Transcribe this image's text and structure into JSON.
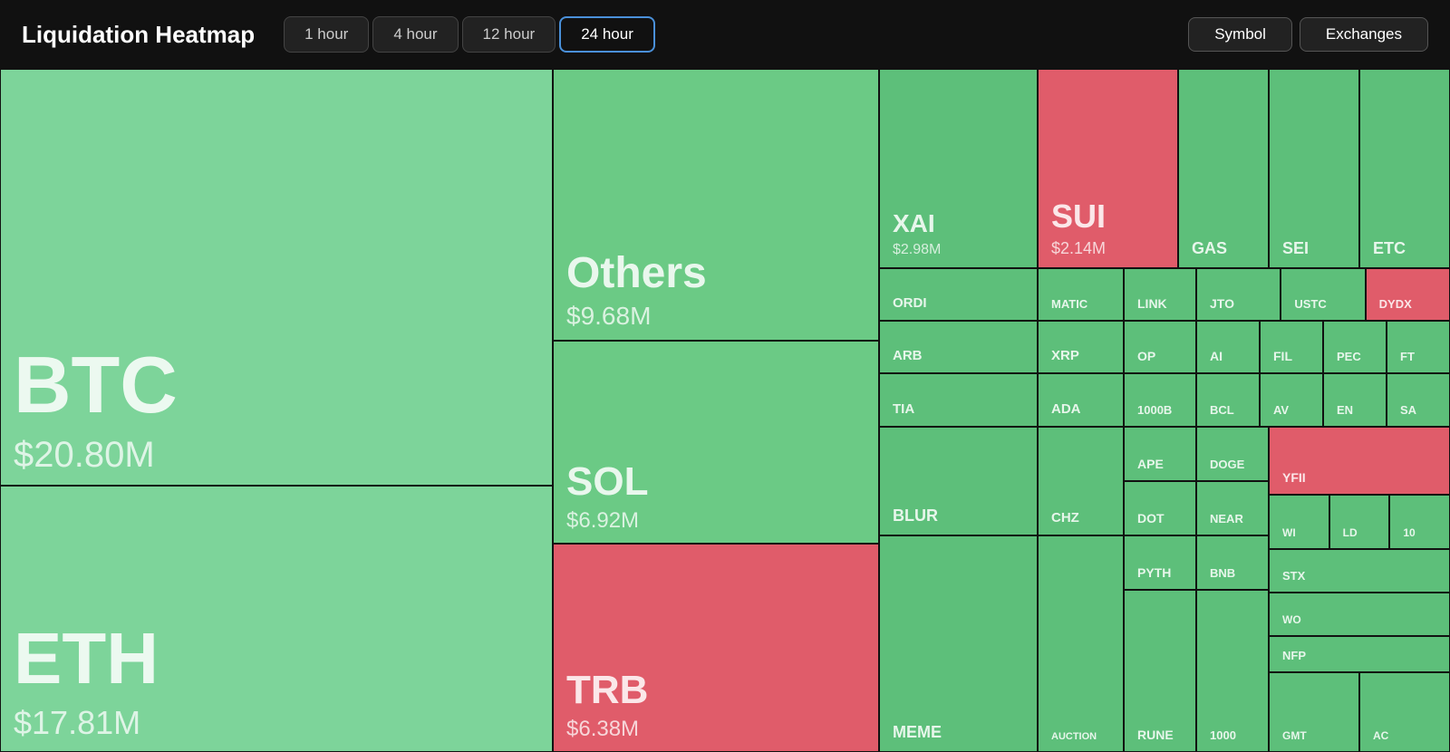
{
  "header": {
    "title": "Liquidation Heatmap",
    "tabs": [
      {
        "label": "1 hour",
        "id": "1h",
        "active": false
      },
      {
        "label": "4 hour",
        "id": "4h",
        "active": false
      },
      {
        "label": "12 hour",
        "id": "12h",
        "active": false
      },
      {
        "label": "24 hour",
        "id": "24h",
        "active": true
      }
    ],
    "right_tabs": [
      {
        "label": "Symbol"
      },
      {
        "label": "Exchanges"
      }
    ]
  },
  "cells": {
    "btc": {
      "name": "BTC",
      "value": "$20.80M",
      "color": "green-light"
    },
    "eth": {
      "name": "ETH",
      "value": "$17.81M",
      "color": "green-light"
    },
    "others": {
      "name": "Others",
      "value": "$9.68M",
      "color": "green-mid"
    },
    "sol": {
      "name": "SOL",
      "value": "$6.92M",
      "color": "green-mid"
    },
    "trb": {
      "name": "TRB",
      "value": "$6.38M",
      "color": "red"
    },
    "xai": {
      "name": "XAI",
      "value": "$2.98M",
      "color": "green"
    },
    "sui": {
      "name": "SUI",
      "value": "$2.14M",
      "color": "red"
    },
    "gas": {
      "name": "GAS",
      "value": "",
      "color": "green"
    },
    "sei": {
      "name": "SEI",
      "value": "",
      "color": "green"
    },
    "etc": {
      "name": "ETC",
      "value": "",
      "color": "green"
    },
    "ordi": {
      "name": "ORDI",
      "value": "",
      "color": "green"
    },
    "matic": {
      "name": "MATIC",
      "value": "",
      "color": "green"
    },
    "link": {
      "name": "LINK",
      "value": "",
      "color": "green"
    },
    "jto": {
      "name": "JTO",
      "value": "",
      "color": "green"
    },
    "ustc": {
      "name": "USTC",
      "value": "",
      "color": "green"
    },
    "dydx": {
      "name": "DYDX",
      "value": "",
      "color": "red"
    },
    "arb": {
      "name": "ARB",
      "value": "",
      "color": "green"
    },
    "xrp": {
      "name": "XRP",
      "value": "",
      "color": "green"
    },
    "op": {
      "name": "OP",
      "value": "",
      "color": "green"
    },
    "ai": {
      "name": "AI",
      "value": "",
      "color": "green"
    },
    "fil": {
      "name": "FIL",
      "value": "",
      "color": "green"
    },
    "pec": {
      "name": "PEC",
      "value": "",
      "color": "green"
    },
    "ft": {
      "name": "FT",
      "value": "",
      "color": "green"
    },
    "tia": {
      "name": "TIA",
      "value": "",
      "color": "green"
    },
    "ada": {
      "name": "ADA",
      "value": "",
      "color": "green"
    },
    "1000b": {
      "name": "1000B",
      "value": "",
      "color": "green"
    },
    "bcl": {
      "name": "BCL",
      "value": "",
      "color": "green"
    },
    "av": {
      "name": "AV",
      "value": "",
      "color": "green"
    },
    "en": {
      "name": "EN",
      "value": "",
      "color": "green"
    },
    "sa": {
      "name": "SA",
      "value": "",
      "color": "green"
    },
    "ape": {
      "name": "APE",
      "value": "",
      "color": "green"
    },
    "doge": {
      "name": "DOGE",
      "value": "",
      "color": "green"
    },
    "yfii": {
      "name": "YFII",
      "value": "",
      "color": "red"
    },
    "wi": {
      "name": "WI",
      "value": "",
      "color": "green"
    },
    "ld": {
      "name": "LD",
      "value": "",
      "color": "green"
    },
    "ten": {
      "name": "10",
      "value": "",
      "color": "green"
    },
    "blur": {
      "name": "BLUR",
      "value": "",
      "color": "green"
    },
    "chz": {
      "name": "CHZ",
      "value": "",
      "color": "green"
    },
    "dot": {
      "name": "DOT",
      "value": "",
      "color": "green"
    },
    "near": {
      "name": "NEAR",
      "value": "",
      "color": "green"
    },
    "pyth": {
      "name": "PYTH",
      "value": "",
      "color": "green"
    },
    "bnb": {
      "name": "BNB",
      "value": "",
      "color": "green"
    },
    "stx": {
      "name": "STX",
      "value": "",
      "color": "green"
    },
    "woo": {
      "name": "WO",
      "value": "",
      "color": "green"
    },
    "nfp": {
      "name": "NFP",
      "value": "",
      "color": "green"
    },
    "meme": {
      "name": "MEME",
      "value": "",
      "color": "green"
    },
    "auction": {
      "name": "AUCTION",
      "value": "",
      "color": "green"
    },
    "rune": {
      "name": "RUNE",
      "value": "",
      "color": "green"
    },
    "1000x": {
      "name": "1000",
      "value": "",
      "color": "green"
    },
    "gmt": {
      "name": "GMT",
      "value": "",
      "color": "green"
    },
    "ac": {
      "name": "AC",
      "value": "",
      "color": "green"
    }
  }
}
